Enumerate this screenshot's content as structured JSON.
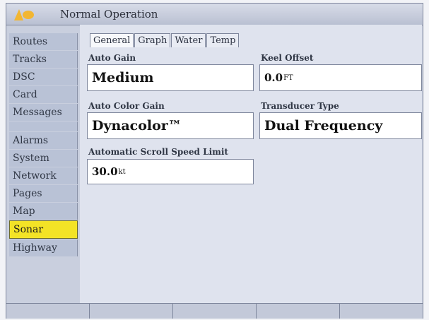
{
  "window": {
    "title": "Normal Operation"
  },
  "sidebar": {
    "items": [
      {
        "label": "Routes"
      },
      {
        "label": "Tracks"
      },
      {
        "label": "DSC"
      },
      {
        "label": "Card"
      },
      {
        "label": "Messages"
      },
      {
        "label": ""
      },
      {
        "label": "Alarms"
      },
      {
        "label": "System"
      },
      {
        "label": "Network"
      },
      {
        "label": "Pages"
      },
      {
        "label": "Map"
      },
      {
        "label": "Sonar",
        "selected": true
      },
      {
        "label": "Highway"
      }
    ]
  },
  "tabs": [
    {
      "label": "General",
      "active": true
    },
    {
      "label": "Graph"
    },
    {
      "label": "Water"
    },
    {
      "label": "Temp"
    }
  ],
  "settings": {
    "auto_gain": {
      "label": "Auto Gain",
      "value": "Medium"
    },
    "keel_offset": {
      "label": "Keel Offset",
      "value": "0.0",
      "unit": "FT"
    },
    "auto_color_gain": {
      "label": "Auto Color Gain",
      "value": "Dynacolor™"
    },
    "transducer_type": {
      "label": "Transducer Type",
      "value": "Dual Frequency"
    },
    "scroll_speed_limit": {
      "label": "Automatic Scroll Speed Limit",
      "value": "30.0",
      "unit": "kt"
    }
  },
  "colors": {
    "selected_nav": "#f3e326",
    "panel_bg": "#dfe3ee",
    "nav_bg": "#b9c2d6"
  }
}
